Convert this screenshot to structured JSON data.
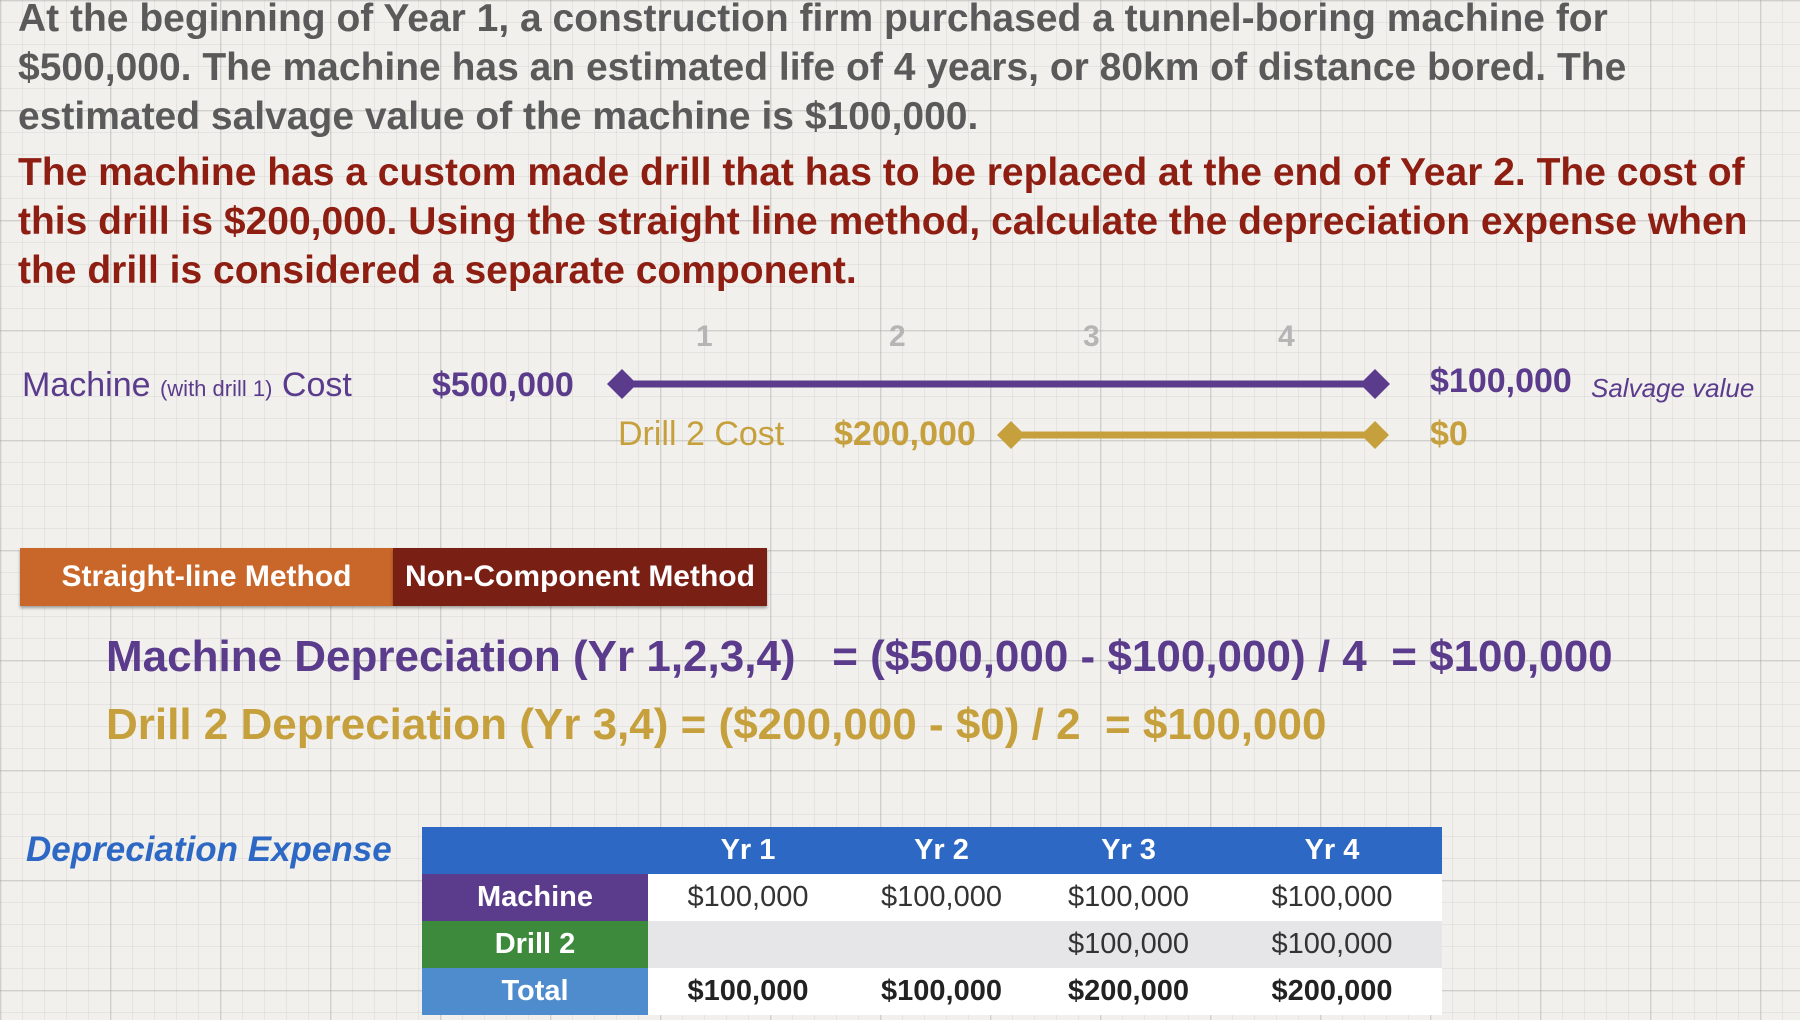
{
  "intro": "At the beginning of Year 1, a construction firm purchased a tunnel-boring machine for $500,000.  The machine has an estimated life of 4 years, or 80km of distance bored.  The estimated salvage value of the machine is $100,000.",
  "question": "The machine has a custom made drill that has to be replaced at the end of Year 2. The cost of this drill is $200,000.  Using the straight line method, calculate the depreciation expense when the drill is considered a separate component.",
  "timeline": {
    "years": [
      "1",
      "2",
      "3",
      "4"
    ],
    "machine": {
      "label_main": "Machine",
      "label_note": "(with drill 1)",
      "label_tail": "Cost",
      "cost": "$500,000",
      "salvage": "$100,000",
      "salvage_note": "Salvage value",
      "color": "#5b3b8c"
    },
    "drill": {
      "label": "Drill 2 Cost",
      "cost": "$200,000",
      "salvage": "$0",
      "color": "#c6a03c"
    }
  },
  "method_tags": {
    "straight_line": "Straight-line Method",
    "non_component": "Non-Component Method"
  },
  "formulas": {
    "machine": "Machine Depreciation (Yr 1,2,3,4)   = ($500,000 - $100,000) / 4  = $100,000",
    "drill": "Drill 2 Depreciation (Yr 3,4) = ($200,000 - $0) / 2  = $100,000"
  },
  "depreciation_table": {
    "title": "Depreciation Expense",
    "headers": [
      "",
      "Yr 1",
      "Yr 2",
      "Yr 3",
      "Yr 4"
    ],
    "rows": [
      {
        "label": "Machine",
        "values": [
          "$100,000",
          "$100,000",
          "$100,000",
          "$100,000"
        ]
      },
      {
        "label": "Drill 2",
        "values": [
          "",
          "",
          "$100,000",
          "$100,000"
        ]
      },
      {
        "label": "Total",
        "values": [
          "$100,000",
          "$100,000",
          "$200,000",
          "$200,000"
        ]
      }
    ]
  },
  "colors": {
    "purple": "#5b3b8c",
    "gold": "#c6a03c",
    "dark_red": "#8e1d12",
    "orange": "#c9672a",
    "blue": "#2d68c4",
    "green": "#3d8a3c",
    "light_blue": "#4f8ccd"
  }
}
